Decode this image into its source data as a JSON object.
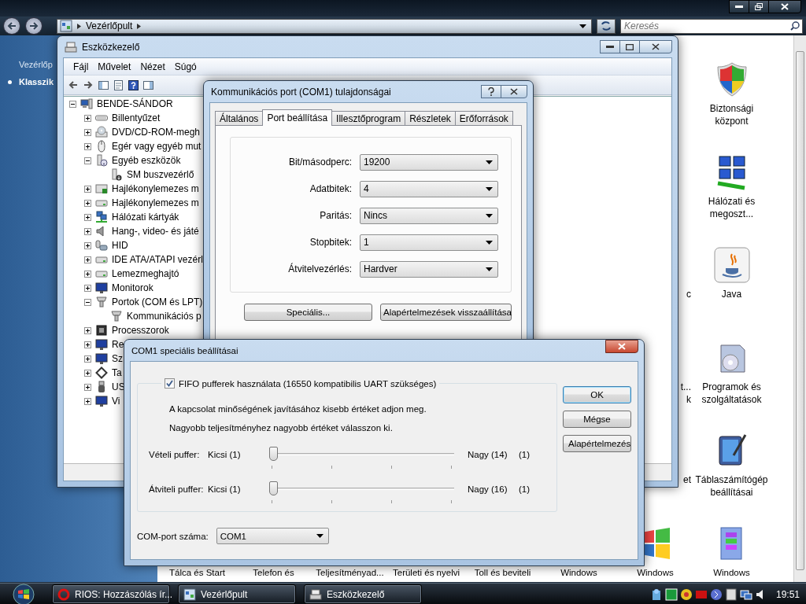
{
  "control_panel": {
    "address": "Vezérlőpult",
    "search": {
      "placeholder": "Keresés"
    },
    "sidebar": [
      {
        "label": "Vezérlőp",
        "selected": false
      },
      {
        "label": "Klasszik",
        "selected": true
      }
    ],
    "rows": [
      {
        "item": {
          "label": "Biztonsági központ"
        }
      },
      {
        "item": {
          "label": "Hálózati és megoszt..."
        }
      },
      {
        "partial_label_lines": [
          "c"
        ],
        "item": {
          "label": "Java"
        }
      },
      {
        "partial_label_lines": [
          "t...",
          "k"
        ],
        "item": {
          "label": "Programok és szolgáltatások"
        }
      },
      {
        "partial_label_lines": [
          "et"
        ],
        "item": {
          "label": "Táblaszámítógép beállításai"
        }
      }
    ],
    "bottom_row": [
      {
        "label": "Tálca és Start"
      },
      {
        "label": "Telefon és"
      },
      {
        "label": "Teljesítményad..."
      },
      {
        "label": "Területi és nyelvi"
      },
      {
        "label": "Toll és beviteli"
      },
      {
        "label": "Windows"
      },
      {
        "label": "Windows"
      },
      {
        "label": "Windows"
      }
    ]
  },
  "device_manager": {
    "title": "Eszközkezelő",
    "menu": [
      "Fájl",
      "Művelet",
      "Nézet",
      "Súgó"
    ],
    "tree": [
      {
        "label": "BENDE-SÁNDOR",
        "expanded": true,
        "children": [
          {
            "label": "Billentyűzet",
            "expanded": false
          },
          {
            "label": "DVD/CD-ROM-megh",
            "expanded": false
          },
          {
            "label": "Egér vagy egyéb mut",
            "expanded": false
          },
          {
            "label": "Egyéb eszközök",
            "expanded": true,
            "children": [
              {
                "label": "SM buszvezérlő"
              }
            ]
          },
          {
            "label": "Hajlékonylemezes m",
            "expanded": false
          },
          {
            "label": "Hajlékonylemezes m",
            "expanded": false
          },
          {
            "label": "Hálózati kártyák",
            "expanded": false
          },
          {
            "label": "Hang-, video- és játé",
            "expanded": false
          },
          {
            "label": "HID",
            "expanded": false
          },
          {
            "label": "IDE ATA/ATAPI vezérl",
            "expanded": false
          },
          {
            "label": "Lemezmeghajtó",
            "expanded": false
          },
          {
            "label": "Monitorok",
            "expanded": false
          },
          {
            "label": "Portok (COM és LPT)",
            "expanded": true,
            "children": [
              {
                "label": "Kommunikációs p"
              }
            ]
          },
          {
            "label": "Processzorok",
            "expanded": false
          },
          {
            "label": "Re",
            "expanded": false
          },
          {
            "label": "Sz",
            "expanded": false
          },
          {
            "label": "Ta",
            "expanded": false
          },
          {
            "label": "US",
            "expanded": false
          },
          {
            "label": "Vi",
            "expanded": false
          }
        ]
      }
    ]
  },
  "properties_dialog": {
    "title": "Kommunikációs port (COM1) tulajdonságai",
    "tabs": [
      {
        "label": "Általános",
        "selected": false
      },
      {
        "label": "Port beállítása",
        "selected": true
      },
      {
        "label": "Illesztőprogram",
        "selected": false
      },
      {
        "label": "Részletek",
        "selected": false
      },
      {
        "label": "Erőforrások",
        "selected": false
      }
    ],
    "fields": [
      {
        "label": "Bit/másodperc:",
        "value": "19200"
      },
      {
        "label": "Adatbitek:",
        "value": "4"
      },
      {
        "label": "Paritás:",
        "value": "Nincs"
      },
      {
        "label": "Stopbitek:",
        "value": "1"
      },
      {
        "label": "Átvitelvezérlés:",
        "value": "Hardver"
      }
    ],
    "buttons": [
      "Speciális...",
      "Alapértelmezések visszaállítása"
    ]
  },
  "advanced_dialog": {
    "title": "COM1 speciális beállításai",
    "fifo": {
      "label": "FIFO pufferek használata (16550 kompatibilis UART szükséges)",
      "checked": true
    },
    "hints": [
      "A kapcsolat minőségének javításához kisebb értéket adjon meg.",
      "Nagyobb teljesítményhez nagyobb értéket válasszon ki."
    ],
    "sliders": [
      {
        "label": "Vételi puffer:",
        "min_label": "Kicsi (1)",
        "max_label": "Nagy (14)",
        "level": 0,
        "reading": "(1)"
      },
      {
        "label": "Átviteli puffer:",
        "min_label": "Kicsi (1)",
        "max_label": "Nagy (16)",
        "level": 0,
        "reading": "(1)"
      }
    ],
    "buttons": [
      {
        "label": "OK",
        "default": true
      },
      {
        "label": "Mégse",
        "default": false
      },
      {
        "label": "Alapértelmezés",
        "default": false
      }
    ],
    "port": {
      "label": "COM-port száma:",
      "value": "COM1"
    }
  },
  "taskbar": {
    "buttons": [
      {
        "label": "RIOS: Hozzászólás ír..."
      },
      {
        "label": "Vezérlőpult"
      },
      {
        "label": "Eszközkezelő"
      }
    ],
    "clock": "19:51"
  }
}
